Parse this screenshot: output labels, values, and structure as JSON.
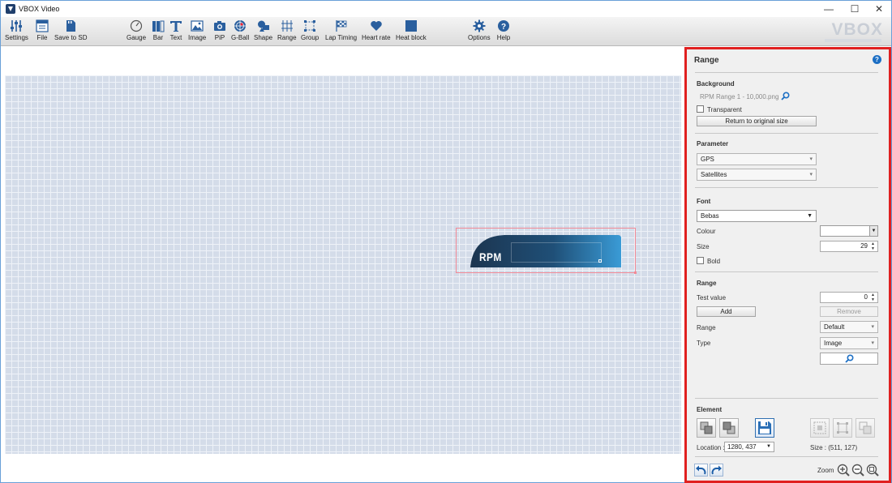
{
  "window": {
    "title": "VBOX Video",
    "minimize": "—",
    "maximize": "☐",
    "close": "✕"
  },
  "toolbar": {
    "items": [
      {
        "label": "Settings"
      },
      {
        "label": "File"
      },
      {
        "label": "Save to SD"
      },
      {
        "label": "Gauge"
      },
      {
        "label": "Bar"
      },
      {
        "label": "Text"
      },
      {
        "label": "Image"
      },
      {
        "label": "PiP"
      },
      {
        "label": "G-Ball"
      },
      {
        "label": "Shape"
      },
      {
        "label": "Range"
      },
      {
        "label": "Group"
      },
      {
        "label": "Lap Timing"
      },
      {
        "label": "Heart rate"
      },
      {
        "label": "Heat block"
      },
      {
        "label": "Options"
      },
      {
        "label": "Help"
      }
    ],
    "brand": "VBOX",
    "accent_color": "#1c6fc4"
  },
  "canvas": {
    "gauge_label": "RPM",
    "gauge_gradient": [
      "#1c3550",
      "#3a9bd6"
    ]
  },
  "panel": {
    "title": "Range",
    "help_glyph": "?",
    "background": {
      "heading": "Background",
      "file": "RPM Range 1 - 10,000.png",
      "transparent_label": "Transparent",
      "transparent_checked": false,
      "reset_button": "Return to original size"
    },
    "parameter": {
      "heading": "Parameter",
      "source": "GPS",
      "channel": "Satellites"
    },
    "font": {
      "heading": "Font",
      "family": "Bebas",
      "colour_label": "Colour",
      "colour_value": "#ffffff",
      "size_label": "Size",
      "size_value": "29",
      "bold_label": "Bold",
      "bold_checked": false
    },
    "range": {
      "heading": "Range",
      "test_value_label": "Test value",
      "test_value": "0",
      "add_button": "Add",
      "remove_button": "Remove",
      "range_label": "Range",
      "range_value": "Default",
      "type_label": "Type",
      "type_value": "Image"
    },
    "element": {
      "heading": "Element",
      "location_label": "Location :",
      "location_value": "1280, 437",
      "size_text": "Size : (511, 127)"
    },
    "zoom_label": "Zoom"
  }
}
